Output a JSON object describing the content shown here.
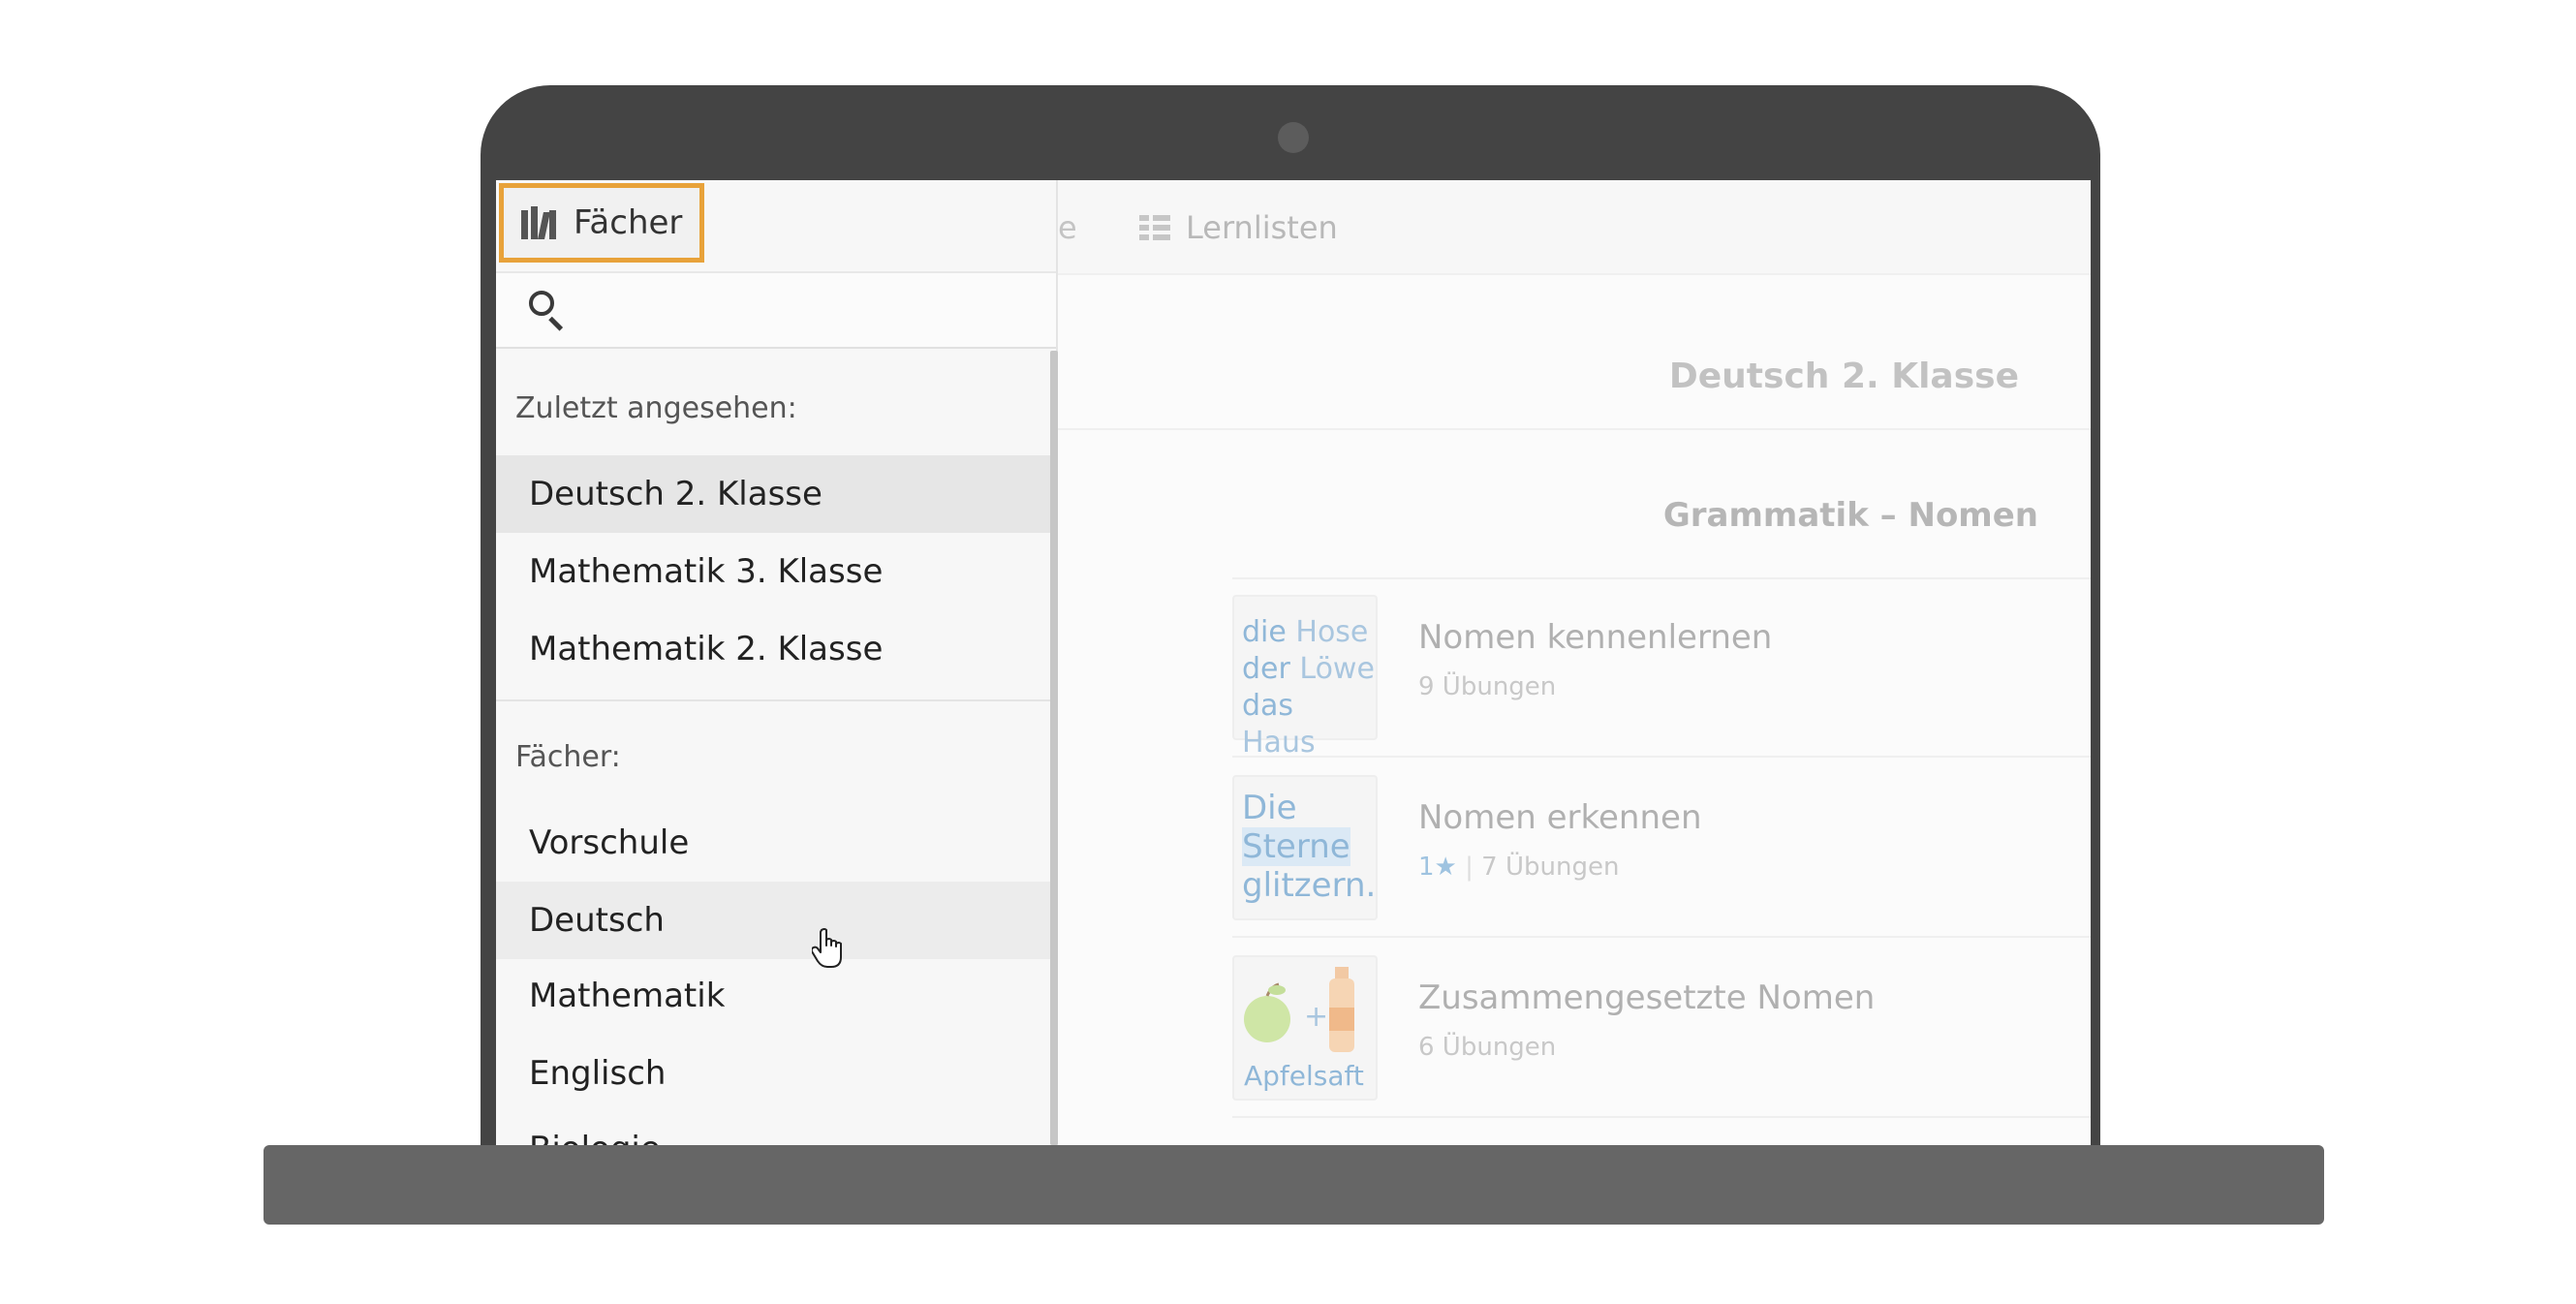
{
  "topnav": {
    "partial_tab": "e",
    "lernlisten_label": "Lernlisten",
    "lernlisten_icon": "list-icon"
  },
  "subject": {
    "title": "Deutsch 2. Klasse"
  },
  "section": {
    "title": "Grammatik – Nomen"
  },
  "topics": [
    {
      "title": "Nomen kennenlernen",
      "sub": "9 Übungen",
      "thumb_lines": [
        [
          "die",
          "Hose"
        ],
        [
          "der",
          "Löwe"
        ],
        [
          "das",
          "Haus"
        ]
      ]
    },
    {
      "title": "Nomen erkennen",
      "badge": "1",
      "badge_icon": "star-icon",
      "sub": "7 Übungen",
      "thumb_lines": [
        "Die",
        "Sterne",
        "glitzern."
      ]
    },
    {
      "title": "Zusammengesetzte Nomen",
      "sub": "6 Übungen",
      "thumb_plus": "+",
      "thumb_word": "Apfelsaft"
    }
  ],
  "dropdown": {
    "button_label": "Fächer",
    "button_icon": "books-icon",
    "search_icon": "search-icon",
    "search_placeholder": "",
    "recent_label": "Zuletzt angesehen:",
    "recent": [
      "Deutsch 2. Klasse",
      "Mathematik 3. Klasse",
      "Mathematik 2. Klasse"
    ],
    "subjects_label": "Fächer:",
    "subjects": [
      "Vorschule",
      "Deutsch",
      "Mathematik",
      "Englisch",
      "Biologie"
    ]
  },
  "colors": {
    "highlight_border": "#e8a23a",
    "device": "#444444",
    "device_base": "#666666",
    "thumb_text": "#8fb7d8"
  }
}
